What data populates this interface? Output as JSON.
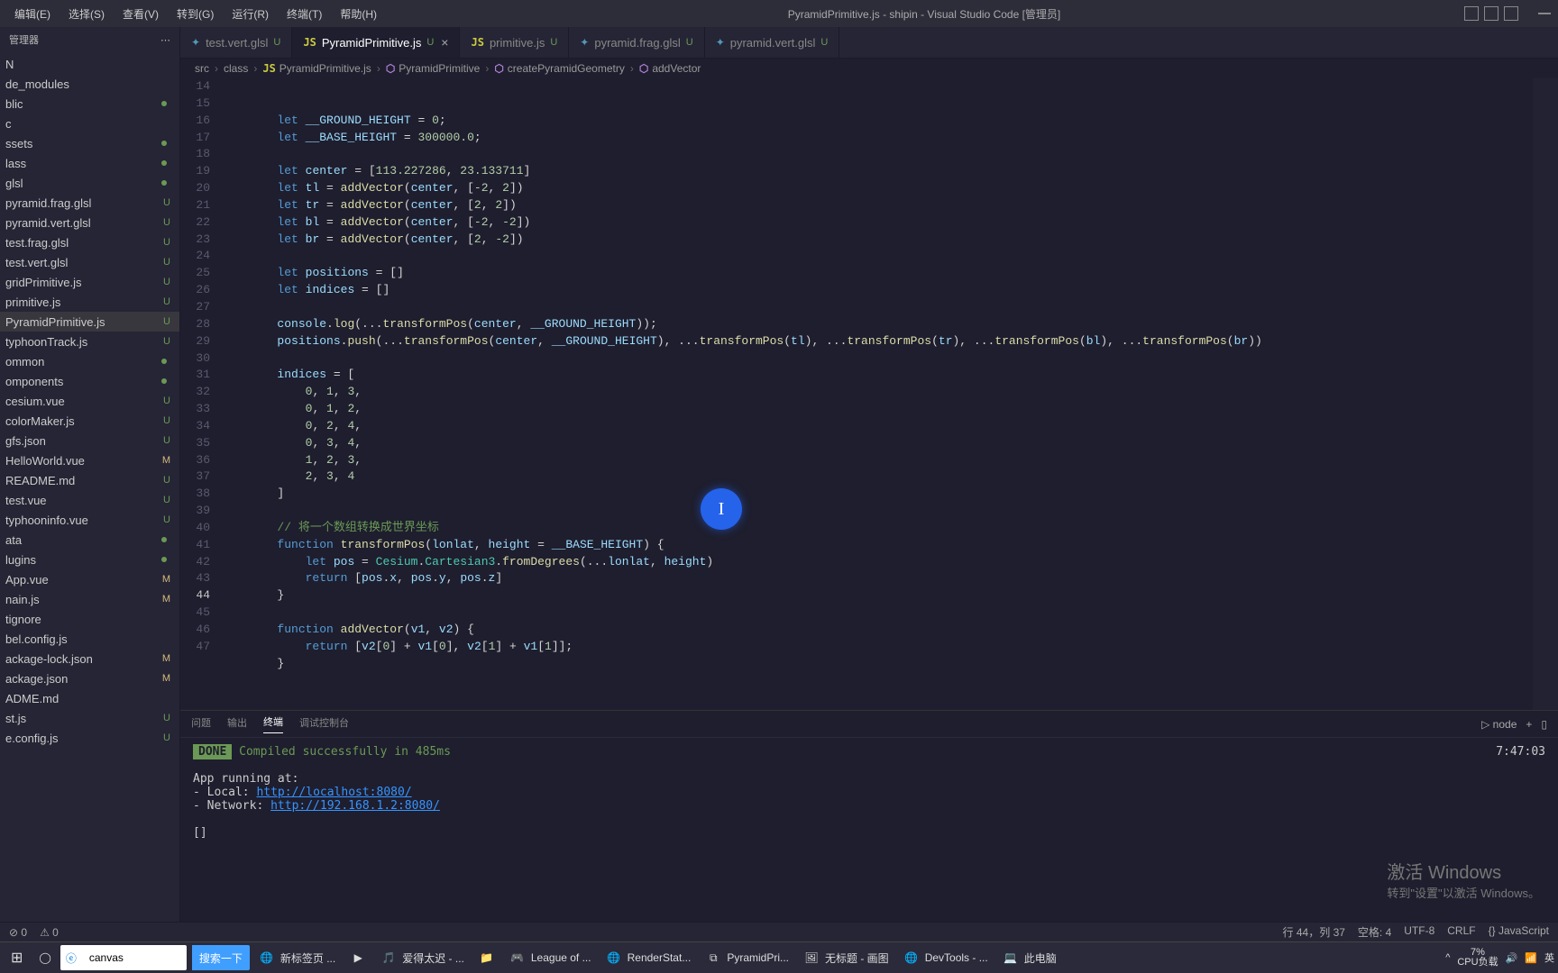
{
  "titlebar": {
    "menus": [
      "编辑(E)",
      "选择(S)",
      "查看(V)",
      "转到(G)",
      "运行(R)",
      "终端(T)",
      "帮助(H)"
    ],
    "title": "PyramidPrimitive.js - shipin - Visual Studio Code [管理员]"
  },
  "sidebar": {
    "header": "管理器",
    "topItems": [
      {
        "label": "N",
        "status": "",
        "dot": false
      },
      {
        "label": "de_modules",
        "status": "",
        "dot": false
      },
      {
        "label": "blic",
        "status": "",
        "dot": true
      },
      {
        "label": "c",
        "status": "",
        "dot": false
      },
      {
        "label": "ssets",
        "status": "",
        "dot": true
      },
      {
        "label": "lass",
        "status": "",
        "dot": true
      },
      {
        "label": "glsl",
        "status": "",
        "dot": true
      },
      {
        "label": "pyramid.frag.glsl",
        "status": "U",
        "dot": false
      },
      {
        "label": "pyramid.vert.glsl",
        "status": "U",
        "dot": false
      },
      {
        "label": "test.frag.glsl",
        "status": "U",
        "dot": false
      },
      {
        "label": "test.vert.glsl",
        "status": "U",
        "dot": false
      },
      {
        "label": "gridPrimitive.js",
        "status": "U",
        "dot": false
      },
      {
        "label": "primitive.js",
        "status": "U",
        "dot": false
      },
      {
        "label": "PyramidPrimitive.js",
        "status": "U",
        "dot": false,
        "selected": true
      },
      {
        "label": "typhoonTrack.js",
        "status": "U",
        "dot": false
      },
      {
        "label": "ommon",
        "status": "",
        "dot": true
      },
      {
        "label": "omponents",
        "status": "",
        "dot": true
      },
      {
        "label": "cesium.vue",
        "status": "U",
        "dot": false
      },
      {
        "label": "colorMaker.js",
        "status": "U",
        "dot": false
      },
      {
        "label": "gfs.json",
        "status": "U",
        "dot": false
      },
      {
        "label": "HelloWorld.vue",
        "status": "M",
        "dot": false
      },
      {
        "label": "README.md",
        "status": "U",
        "dot": false
      },
      {
        "label": "test.vue",
        "status": "U",
        "dot": false
      },
      {
        "label": "typhooninfo.vue",
        "status": "U",
        "dot": false
      },
      {
        "label": "ata",
        "status": "",
        "dot": true
      },
      {
        "label": "lugins",
        "status": "",
        "dot": true
      },
      {
        "label": "App.vue",
        "status": "M",
        "dot": false
      },
      {
        "label": "nain.js",
        "status": "M",
        "dot": false
      },
      {
        "label": "tignore",
        "status": "",
        "dot": false
      },
      {
        "label": "bel.config.js",
        "status": "",
        "dot": false
      },
      {
        "label": "ackage-lock.json",
        "status": "M",
        "dot": false
      },
      {
        "label": "ackage.json",
        "status": "M",
        "dot": false
      },
      {
        "label": "ADME.md",
        "status": "",
        "dot": false
      },
      {
        "label": "st.js",
        "status": "U",
        "dot": false
      },
      {
        "label": "e.config.js",
        "status": "U",
        "dot": false
      }
    ]
  },
  "tabs": [
    {
      "icon": "glsl",
      "iconText": "✦",
      "name": "test.vert.glsl",
      "status": "U",
      "active": false,
      "close": false
    },
    {
      "icon": "js",
      "iconText": "JS",
      "name": "PyramidPrimitive.js",
      "status": "U",
      "active": true,
      "close": true
    },
    {
      "icon": "js",
      "iconText": "JS",
      "name": "primitive.js",
      "status": "U",
      "active": false,
      "close": false
    },
    {
      "icon": "glsl",
      "iconText": "✦",
      "name": "pyramid.frag.glsl",
      "status": "U",
      "active": false,
      "close": false
    },
    {
      "icon": "glsl",
      "iconText": "✦",
      "name": "pyramid.vert.glsl",
      "status": "U",
      "active": false,
      "close": false
    }
  ],
  "breadcrumbs": [
    {
      "text": "src",
      "icon": ""
    },
    {
      "text": "class",
      "icon": ""
    },
    {
      "text": "PyramidPrimitive.js",
      "icon": "JS"
    },
    {
      "text": "PyramidPrimitive",
      "icon": "fn"
    },
    {
      "text": "createPyramidGeometry",
      "icon": "fn"
    },
    {
      "text": "addVector",
      "icon": "fn"
    }
  ],
  "lineStart": 14,
  "activeLine": 44,
  "code": [
    "        <span class='kw'>let</span> <span class='var'>__GROUND_HEIGHT</span> = <span class='num'>0</span>;",
    "        <span class='kw'>let</span> <span class='var'>__BASE_HEIGHT</span> = <span class='num'>300000.0</span>;",
    "",
    "        <span class='kw'>let</span> <span class='var'>center</span> = [<span class='num'>113.227286</span>, <span class='num'>23.133711</span>]",
    "        <span class='kw'>let</span> <span class='var'>tl</span> = <span class='fn'>addVector</span>(<span class='var'>center</span>, [<span class='num'>-2</span>, <span class='num'>2</span>])",
    "        <span class='kw'>let</span> <span class='var'>tr</span> = <span class='fn'>addVector</span>(<span class='var'>center</span>, [<span class='num'>2</span>, <span class='num'>2</span>])",
    "        <span class='kw'>let</span> <span class='var'>bl</span> = <span class='fn'>addVector</span>(<span class='var'>center</span>, [<span class='num'>-2</span>, <span class='num'>-2</span>])",
    "        <span class='kw'>let</span> <span class='var'>br</span> = <span class='fn'>addVector</span>(<span class='var'>center</span>, [<span class='num'>2</span>, <span class='num'>-2</span>])",
    "",
    "        <span class='kw'>let</span> <span class='var'>positions</span> = []",
    "        <span class='kw'>let</span> <span class='var'>indices</span> = []",
    "",
    "        <span class='var'>console</span>.<span class='fn'>log</span>(...<span class='fn'>transformPos</span>(<span class='var'>center</span>, <span class='var'>__GROUND_HEIGHT</span>));",
    "        <span class='var'>positions</span>.<span class='fn'>push</span>(...<span class='fn'>transformPos</span>(<span class='var'>center</span>, <span class='var'>__GROUND_HEIGHT</span>), ...<span class='fn'>transformPos</span>(<span class='var'>tl</span>), ...<span class='fn'>transformPos</span>(<span class='var'>tr</span>), ...<span class='fn'>transformPos</span>(<span class='var'>bl</span>), ...<span class='fn'>transformPos</span>(<span class='var'>br</span>))",
    "",
    "        <span class='var'>indices</span> = [",
    "            <span class='num'>0</span>, <span class='num'>1</span>, <span class='num'>3</span>,",
    "            <span class='num'>0</span>, <span class='num'>1</span>, <span class='num'>2</span>,",
    "            <span class='num'>0</span>, <span class='num'>2</span>, <span class='num'>4</span>,",
    "            <span class='num'>0</span>, <span class='num'>3</span>, <span class='num'>4</span>,",
    "            <span class='num'>1</span>, <span class='num'>2</span>, <span class='num'>3</span>,",
    "            <span class='num'>2</span>, <span class='num'>3</span>, <span class='num'>4</span>",
    "        ]",
    "",
    "        <span class='cmt'>// 将一个数组转换成世界坐标</span>",
    "        <span class='kw'>function</span> <span class='fn'>transformPos</span>(<span class='var'>lonlat</span>, <span class='var'>height</span> = <span class='var'>__BASE_HEIGHT</span>) {",
    "            <span class='kw'>let</span> <span class='var'>pos</span> = <span class='cls'>Cesium</span>.<span class='cls'>Cartesian3</span>.<span class='fn'>fromDegrees</span>(...<span class='var'>lonlat</span>, <span class='var'>height</span>)",
    "            <span class='kw'>return</span> [<span class='var'>pos</span>.<span class='var'>x</span>, <span class='var'>pos</span>.<span class='var'>y</span>, <span class='var'>pos</span>.<span class='var'>z</span>]",
    "        }",
    "",
    "        <span class='kw'>function</span> <span class='fn'>addVector</span>(<span class='var'>v1</span>, <span class='var'>v2</span>) {",
    "            <span class='kw'>return</span> [<span class='var'>v2</span>[<span class='num'>0</span>] + <span class='var'>v1</span>[<span class='num'>0</span>], <span class='var'>v2</span>[<span class='num'>1</span>] + <span class='var'>v1</span>[<span class='num'>1</span>]];",
    "        }",
    ""
  ],
  "terminal": {
    "tabs": [
      "问题",
      "输出",
      "终端",
      "调试控制台"
    ],
    "activeTab": 2,
    "rightLabel": "node",
    "badge": "DONE",
    "compiled": " Compiled successfully in 485ms",
    "time": "7:47:03",
    "running": "App running at:",
    "localLabel": "- Local:   ",
    "localUrl": "http://localhost:8080/",
    "networkLabel": "- Network: ",
    "networkUrl": "http://192.168.1.2:8080/",
    "cursor": "[]"
  },
  "statusbar": {
    "errors": "⊘ 0",
    "warnings": "⚠ 0",
    "pos": "行 44，列 37",
    "spaces": "空格: 4",
    "encoding": "UTF-8",
    "eol": "CRLF",
    "lang": "JavaScript"
  },
  "activate": {
    "main": "激活 Windows",
    "sub": "转到\"设置\"以激活 Windows。"
  },
  "taskbar": {
    "searchValue": "canvas",
    "searchBtn": "搜索一下",
    "items": [
      {
        "icon": "🌐",
        "label": "新标签页 ..."
      },
      {
        "icon": "▶",
        "label": ""
      },
      {
        "icon": "🎵",
        "label": "爱得太迟 - ..."
      },
      {
        "icon": "📁",
        "label": ""
      },
      {
        "icon": "🎮",
        "label": "League of ..."
      },
      {
        "icon": "🌐",
        "label": "RenderStat..."
      },
      {
        "icon": "⧉",
        "label": "PyramidPri..."
      },
      {
        "icon": "🖼",
        "label": "无标题 - 画图"
      },
      {
        "icon": "🌐",
        "label": "DevTools - ..."
      },
      {
        "icon": "💻",
        "label": "此电脑"
      }
    ],
    "tray": {
      "cpu1": "7%",
      "cpu2": "CPU负载",
      "ime": "英"
    }
  }
}
